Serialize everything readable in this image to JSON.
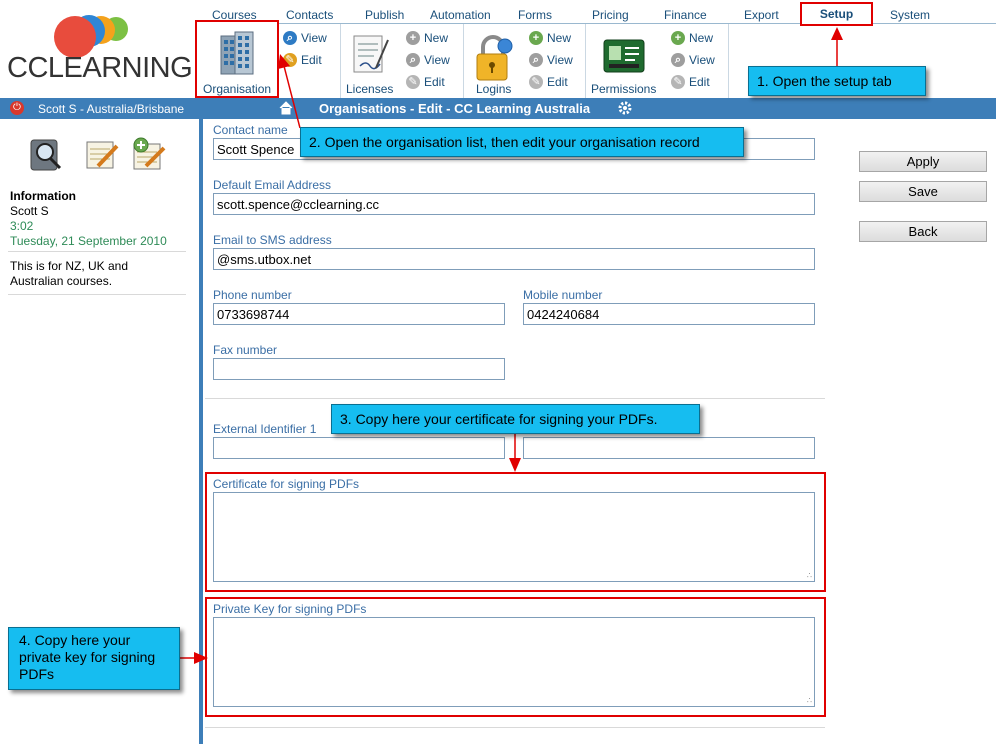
{
  "brand": {
    "logo_text_bold": "CC",
    "logo_text_thin": "LEARNING",
    "circle_colors": [
      "#e84c3d",
      "#2f86d6",
      "#f4a21c",
      "#7cc043"
    ]
  },
  "nav": {
    "tabs": [
      "Courses",
      "Contacts",
      "Publish",
      "Automation",
      "Forms",
      "Pricing",
      "Finance",
      "Export",
      "Setup",
      "System"
    ],
    "active_tab": "Setup"
  },
  "ribbon": {
    "organisation": {
      "label": "Organisation",
      "view": "View",
      "edit": "Edit"
    },
    "licenses": {
      "label": "Licenses",
      "new": "New",
      "view": "View",
      "edit": "Edit"
    },
    "logins": {
      "label": "Logins",
      "new": "New",
      "view": "View",
      "edit": "Edit"
    },
    "permissions": {
      "label": "Permissions",
      "new": "New",
      "view": "View",
      "edit": "Edit"
    }
  },
  "status_bar": {
    "user_location": "Scott S - Australia/Brisbane",
    "page_title": "Organisations - Edit - CC Learning Australia"
  },
  "sidebar": {
    "info_heading": "Information",
    "user_name": "Scott S",
    "time": "3:02",
    "date": "Tuesday, 21 September 2010",
    "note_line1": "This is for NZ, UK and",
    "note_line2": "Australian courses."
  },
  "form": {
    "contact_name_label": "Contact name",
    "contact_name_value": "Scott Spence",
    "default_email_label": "Default Email Address",
    "default_email_value": "scott.spence@cclearning.cc",
    "sms_email_label": "Email to SMS address",
    "sms_email_value": "@sms.utbox.net",
    "phone_label": "Phone number",
    "phone_value": "0733698744",
    "mobile_label": "Mobile number",
    "mobile_value": "0424240684",
    "fax_label": "Fax number",
    "fax_value": "",
    "external_id_label": "External Identifier 1",
    "external_id_value": "",
    "external_id_2_value": "",
    "certificate_label": "Certificate for signing PDFs",
    "private_key_label": "Private Key for signing PDFs"
  },
  "buttons": {
    "apply": "Apply",
    "save": "Save",
    "back": "Back"
  },
  "callouts": {
    "step1": "1. Open the setup tab",
    "step2": "2. Open the organisation list, then edit your organisation record",
    "step3": "3. Copy here your certificate for signing your PDFs.",
    "step4_line1": "4. Copy here your",
    "step4_line2": "private key for signing",
    "step4_line3": "PDFs"
  },
  "colors": {
    "accent_blue": "#3d7eb8",
    "callout": "#16bdf0",
    "highlight_red": "#e00000",
    "link": "#1a4f7a"
  }
}
